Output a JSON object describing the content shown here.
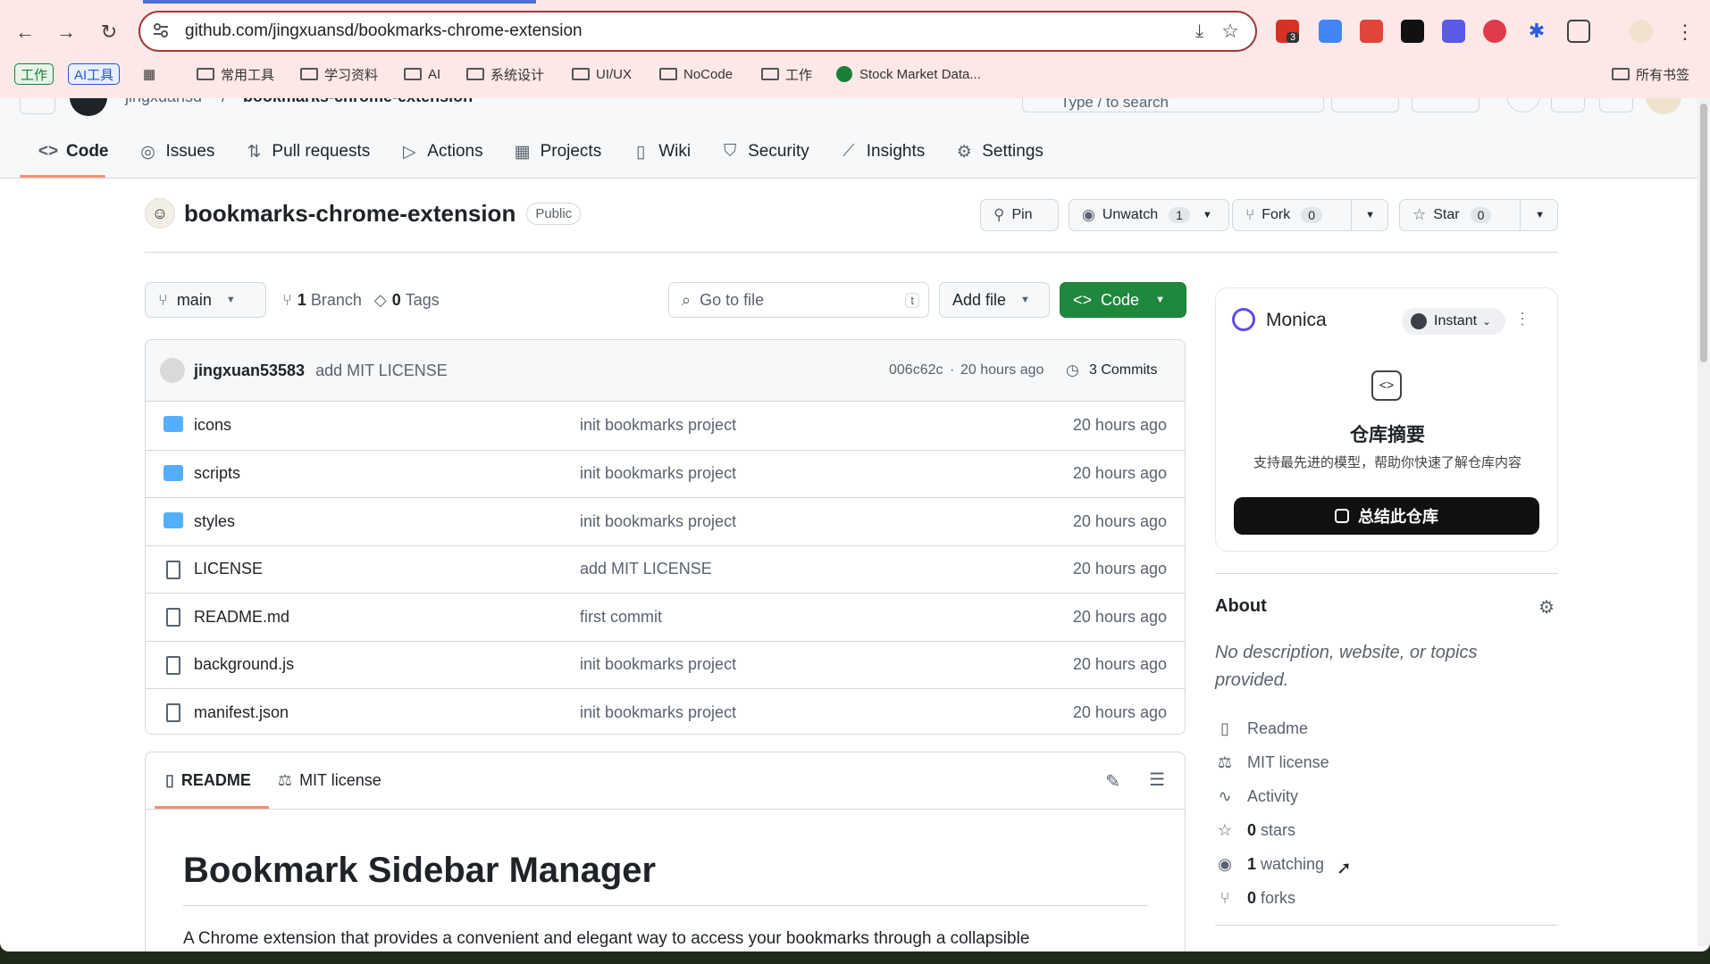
{
  "browser": {
    "url": "github.com/jingxuansd/bookmarks-chrome-extension",
    "bookmarks": [
      "常用工具",
      "学习资料",
      "AI",
      "系统设计",
      "UI/UX",
      "NoCode",
      "工作",
      "Stock Market Data...",
      "所有书签"
    ],
    "tags": [
      "工作",
      "AI工具"
    ],
    "ext_badge": "3"
  },
  "gh_header": {
    "owner": "jingxuansd",
    "repo_faded": "bookmarks-chrome-extension",
    "search": "Type / to search"
  },
  "tabs": [
    {
      "label": "Code",
      "icon": "code-icon"
    },
    {
      "label": "Issues",
      "icon": "issue-icon"
    },
    {
      "label": "Pull requests",
      "icon": "pull-request-icon"
    },
    {
      "label": "Actions",
      "icon": "play-icon"
    },
    {
      "label": "Projects",
      "icon": "table-icon"
    },
    {
      "label": "Wiki",
      "icon": "book-icon"
    },
    {
      "label": "Security",
      "icon": "shield-icon"
    },
    {
      "label": "Insights",
      "icon": "graph-icon"
    },
    {
      "label": "Settings",
      "icon": "gear-icon"
    }
  ],
  "repo": {
    "name": "bookmarks-chrome-extension",
    "visibility": "Public",
    "pin": "Pin",
    "unwatch": "Unwatch",
    "watch_count": "1",
    "fork": "Fork",
    "fork_count": "0",
    "star": "Star",
    "star_count": "0"
  },
  "toolbar": {
    "branch": "main",
    "branches_num": "1",
    "branches_label": "Branch",
    "tags_num": "0",
    "tags_label": "Tags",
    "search_placeholder": "Go to file",
    "search_key": "t",
    "add_file": "Add file",
    "code": "Code"
  },
  "commit": {
    "author": "jingxuan53583",
    "message": "add MIT LICENSE",
    "hash": "006c62c",
    "age": "20 hours ago",
    "commits": "3 Commits"
  },
  "files": [
    {
      "name": "icons",
      "type": "dir",
      "message": "init bookmarks project",
      "age": "20 hours ago"
    },
    {
      "name": "scripts",
      "type": "dir",
      "message": "init bookmarks project",
      "age": "20 hours ago"
    },
    {
      "name": "styles",
      "type": "dir",
      "message": "init bookmarks project",
      "age": "20 hours ago"
    },
    {
      "name": "LICENSE",
      "type": "file",
      "message": "add MIT LICENSE",
      "age": "20 hours ago"
    },
    {
      "name": "README.md",
      "type": "file",
      "message": "first commit",
      "age": "20 hours ago"
    },
    {
      "name": "background.js",
      "type": "file",
      "message": "init bookmarks project",
      "age": "20 hours ago"
    },
    {
      "name": "manifest.json",
      "type": "file",
      "message": "init bookmarks project",
      "age": "20 hours ago"
    }
  ],
  "readme": {
    "tab_readme": "README",
    "tab_license": "MIT license",
    "heading": "Bookmark Sidebar Manager",
    "intro": "A Chrome extension that provides a convenient and elegant way to access your bookmarks through a collapsible"
  },
  "monica": {
    "name": "Monica",
    "mode": "Instant",
    "title": "仓库摘要",
    "desc": "支持最先进的模型，帮助你快速了解仓库内容",
    "button": "总结此仓库"
  },
  "about": {
    "title": "About",
    "description": "No description, website, or topics provided.",
    "links": [
      {
        "label": "Readme",
        "icon": "book-icon"
      },
      {
        "label": "MIT license",
        "icon": "scale-icon"
      },
      {
        "label": "Activity",
        "icon": "pulse-icon"
      },
      {
        "num": "0",
        "label": "stars",
        "icon": "star-icon"
      },
      {
        "num": "1",
        "label": "watching",
        "icon": "eye-icon"
      },
      {
        "num": "0",
        "label": "forks",
        "icon": "fork-icon"
      }
    ]
  },
  "colors": {
    "accent": "#1f883d",
    "tab_underline": "#fd8c73",
    "folder": "#54aeff",
    "browser_bg": "#fce8e6"
  }
}
